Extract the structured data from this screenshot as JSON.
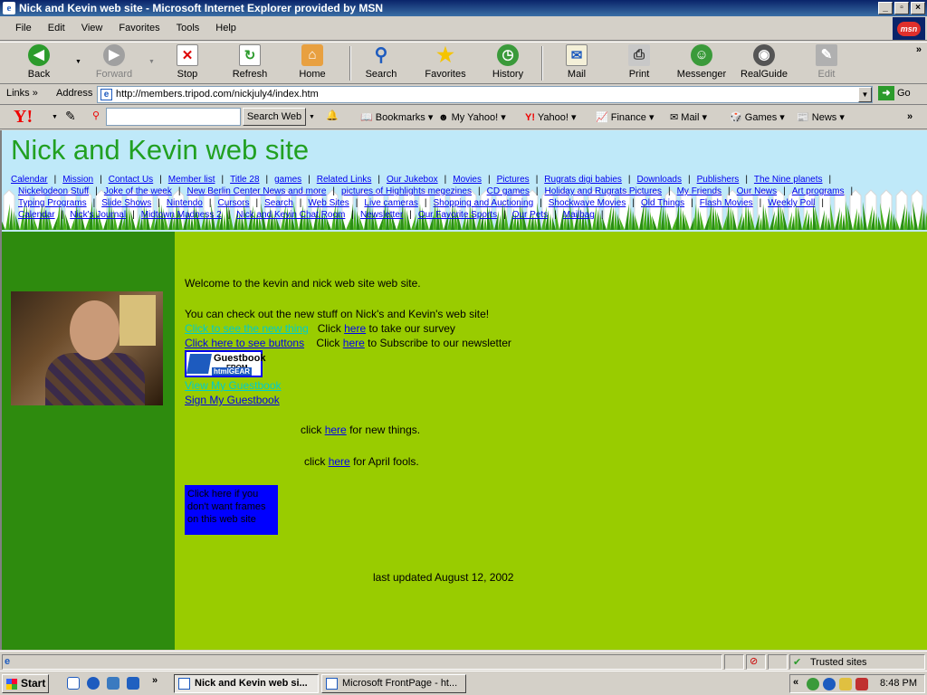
{
  "window": {
    "title": "Nick and Kevin web site - Microsoft Internet Explorer provided by MSN"
  },
  "menu": [
    "File",
    "Edit",
    "View",
    "Favorites",
    "Tools",
    "Help"
  ],
  "toolbar": {
    "back": "Back",
    "forward": "Forward",
    "stop": "Stop",
    "refresh": "Refresh",
    "home": "Home",
    "search": "Search",
    "favorites": "Favorites",
    "history": "History",
    "mail": "Mail",
    "print": "Print",
    "messenger": "Messenger",
    "realguide": "RealGuide",
    "edit": "Edit"
  },
  "address": {
    "links_label": "Links",
    "label": "Address",
    "url": "http://members.tripod.com/nickjuly4/index.htm",
    "go": "Go"
  },
  "yahoo": {
    "search_button": "Search Web",
    "items": [
      "Bookmarks",
      "My Yahoo!",
      "Yahoo!",
      "Finance",
      "Mail",
      "Games",
      "News"
    ]
  },
  "page": {
    "site_title": "Nick and Kevin web site",
    "nav_rows": [
      [
        "Calendar",
        "Mission",
        "Contact Us",
        "Member list",
        "Title 28",
        "games",
        "Related Links",
        "Our Jukebox",
        "Movies",
        "Pictures",
        "Rugrats digi babies",
        "Downloads",
        "Publishers",
        "The Nine planets"
      ],
      [
        "Nickelodeon Stuff",
        "Joke of the week",
        "New Berlin Center News and more",
        "pictures of Highlights megezines",
        "CD games",
        "Holiday and Rugrats Pictures",
        "My Friends",
        "Our News",
        "Art programs"
      ],
      [
        "Typing Programs",
        "Slide Shows",
        "Nintendo",
        "Cursors",
        "Search",
        "Web Sites",
        "Live cameras",
        "Shopping and Auctioning",
        "Shockwave Movies",
        "Old Things",
        "Flash Movies",
        "Weekly Poll"
      ],
      [
        "Calendar",
        "Nick's Journal",
        "Midtown Madness 2",
        "Nick and Kevin Chat Room",
        "Newsletter",
        "Our Favorite Sports",
        "Our Pets",
        "Mailbag"
      ]
    ],
    "welcome": "Welcome to the kevin and nick web site web site.",
    "checkout": "You can check out the new stuff on Nick's and Kevin's web site!",
    "new_thing_link": "Click to see the new thing",
    "click": "Click",
    "here": "here",
    "survey_suffix": "to take our survey",
    "buttons_link": "Click here to see buttons",
    "newsletter_suffix": "to Subscribe to our newsletter",
    "guestbook_img": {
      "title": "Guestbook",
      "from": "FROM",
      "brand": "htmlGEAR"
    },
    "view_guestbook": "View My Guestbook",
    "sign_guestbook": "Sign My Guestbook",
    "click_lower": "click",
    "new_things_suffix": "for new things.",
    "april_suffix": "for April fools.",
    "no_frames": "Click here if you don't want frames on this web site",
    "updated": "last updated August 12, 2002"
  },
  "status": {
    "zone": "Trusted sites"
  },
  "taskbar": {
    "start": "Start",
    "tasks": [
      "Nick and Kevin web si...",
      "Microsoft FrontPage - ht..."
    ],
    "clock": "8:48 PM"
  },
  "icons": [
    "ie-icon",
    "back-icon",
    "forward-icon",
    "stop-icon",
    "refresh-icon",
    "home-icon",
    "search-icon",
    "favorites-icon",
    "history-icon",
    "mail-icon",
    "print-icon",
    "messenger-icon",
    "realguide-icon",
    "edit-icon",
    "msn-logo",
    "yahoo-logo"
  ]
}
